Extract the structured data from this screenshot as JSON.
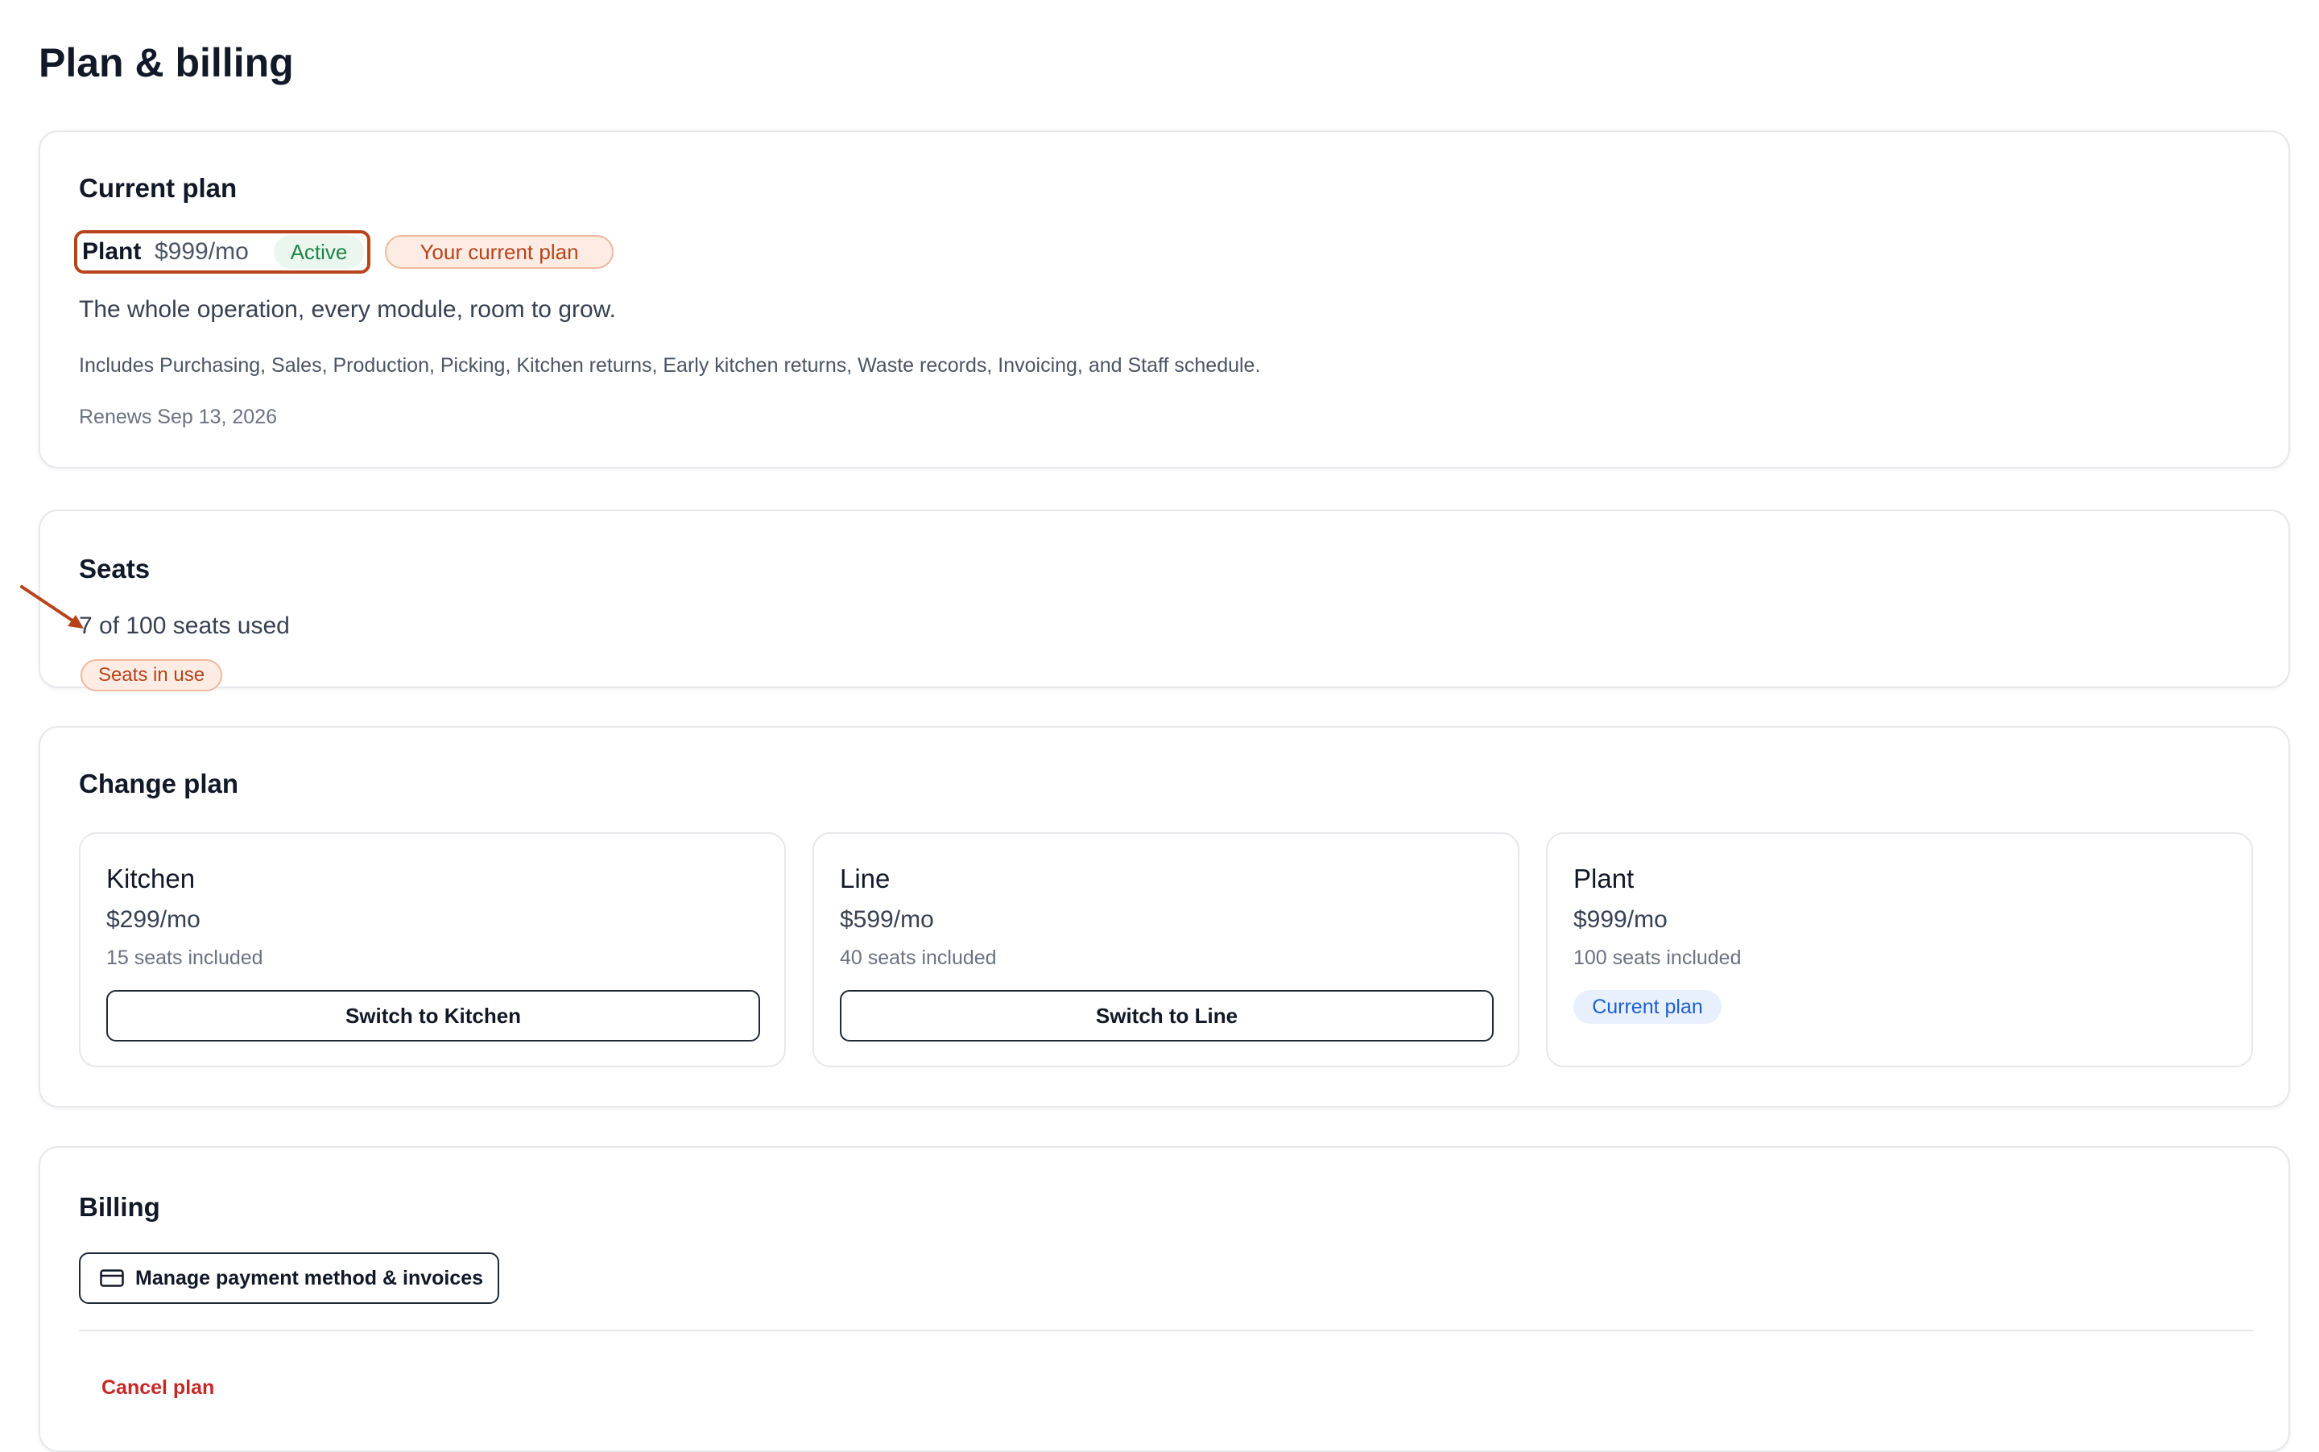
{
  "page": {
    "title": "Plan & billing"
  },
  "current_plan": {
    "heading": "Current plan",
    "name": "Plant",
    "price": "$999/mo",
    "status_badge": "Active",
    "current_badge": "Your current plan",
    "description": "The whole operation, every module, room to grow.",
    "includes": "Includes Purchasing, Sales, Production, Picking, Kitchen returns, Early kitchen returns, Waste records, Invoicing, and Staff schedule.",
    "renews": "Renews Sep 13, 2026"
  },
  "seats": {
    "heading": "Seats",
    "used": "7 of 100 seats used",
    "badge": "Seats in use"
  },
  "change_plan": {
    "heading": "Change plan",
    "options": [
      {
        "name": "Kitchen",
        "price": "$299/mo",
        "seats": "15 seats included",
        "action": "Switch to Kitchen"
      },
      {
        "name": "Line",
        "price": "$599/mo",
        "seats": "40 seats included",
        "action": "Switch to Line"
      },
      {
        "name": "Plant",
        "price": "$999/mo",
        "seats": "100 seats included",
        "badge": "Current plan"
      }
    ]
  },
  "billing": {
    "heading": "Billing",
    "manage_label": "Manage payment method & invoices",
    "manage_icon": "credit-card-icon",
    "cancel_label": "Cancel plan"
  },
  "colors": {
    "annotation": "#b8431b",
    "active_green": "#1e8449",
    "current_blue": "#1d5fd1",
    "danger_red": "#c62828"
  }
}
